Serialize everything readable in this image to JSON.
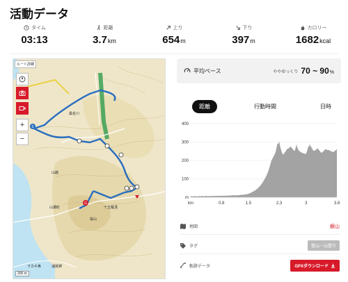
{
  "page": {
    "title": "活動データ"
  },
  "stats": [
    {
      "label": "タイム",
      "value": "03:13",
      "unit": ""
    },
    {
      "label": "距離",
      "value": "3.7",
      "unit": "km"
    },
    {
      "label": "上り",
      "value": "654",
      "unit": "m"
    },
    {
      "label": "下り",
      "value": "397",
      "unit": "m"
    },
    {
      "label": "カロリー",
      "value": "1682",
      "unit": "kcal"
    }
  ],
  "map": {
    "route_label": "ルート詳細",
    "scale": "200 m",
    "place_labels": [
      "山越",
      "山瀬町",
      "桑名川",
      "桜山",
      "十五羅漢",
      "ヲカギ鼻",
      "浦賀岬"
    ]
  },
  "pace": {
    "label": "平均ペース",
    "sub": "ややゆっくり",
    "value": "70 ~ 90",
    "unit": "%"
  },
  "tabs": [
    "距離",
    "行動時間",
    "日時"
  ],
  "chart_data": {
    "type": "area",
    "title": "",
    "xlabel": "km",
    "ylabel": "m",
    "x_ticks": [
      "km",
      "0.8",
      "1.5",
      "2.3",
      "3",
      "3.8"
    ],
    "y_ticks": [
      "m",
      "100",
      "200",
      "300",
      "400"
    ],
    "xlim": [
      0,
      3.8
    ],
    "ylim": [
      0,
      400
    ],
    "x": [
      0,
      0.1,
      0.2,
      0.3,
      0.4,
      0.5,
      0.6,
      0.7,
      0.8,
      0.9,
      1.0,
      1.1,
      1.2,
      1.3,
      1.4,
      1.5,
      1.6,
      1.7,
      1.8,
      1.9,
      2.0,
      2.1,
      2.2,
      2.25,
      2.3,
      2.35,
      2.4,
      2.5,
      2.6,
      2.7,
      2.75,
      2.8,
      2.9,
      3.0,
      3.05,
      3.1,
      3.2,
      3.3,
      3.4,
      3.5,
      3.6,
      3.7,
      3.8
    ],
    "values": [
      5,
      5,
      5,
      6,
      6,
      6,
      7,
      7,
      8,
      8,
      9,
      10,
      10,
      12,
      14,
      18,
      28,
      40,
      60,
      90,
      130,
      200,
      240,
      285,
      300,
      255,
      230,
      260,
      275,
      250,
      285,
      255,
      240,
      235,
      270,
      285,
      250,
      265,
      240,
      260,
      255,
      245,
      260
    ],
    "fill_color": "#999999"
  },
  "info": {
    "map_label": "地図",
    "map_value": "銀山",
    "tag_label": "タグ",
    "tag_value": "登山・山登り",
    "track_label": "軌跡データ",
    "gpx_button": "GPXダウンロード"
  },
  "colors": {
    "accent": "#d71a2a",
    "route": "#2a6fbf"
  }
}
